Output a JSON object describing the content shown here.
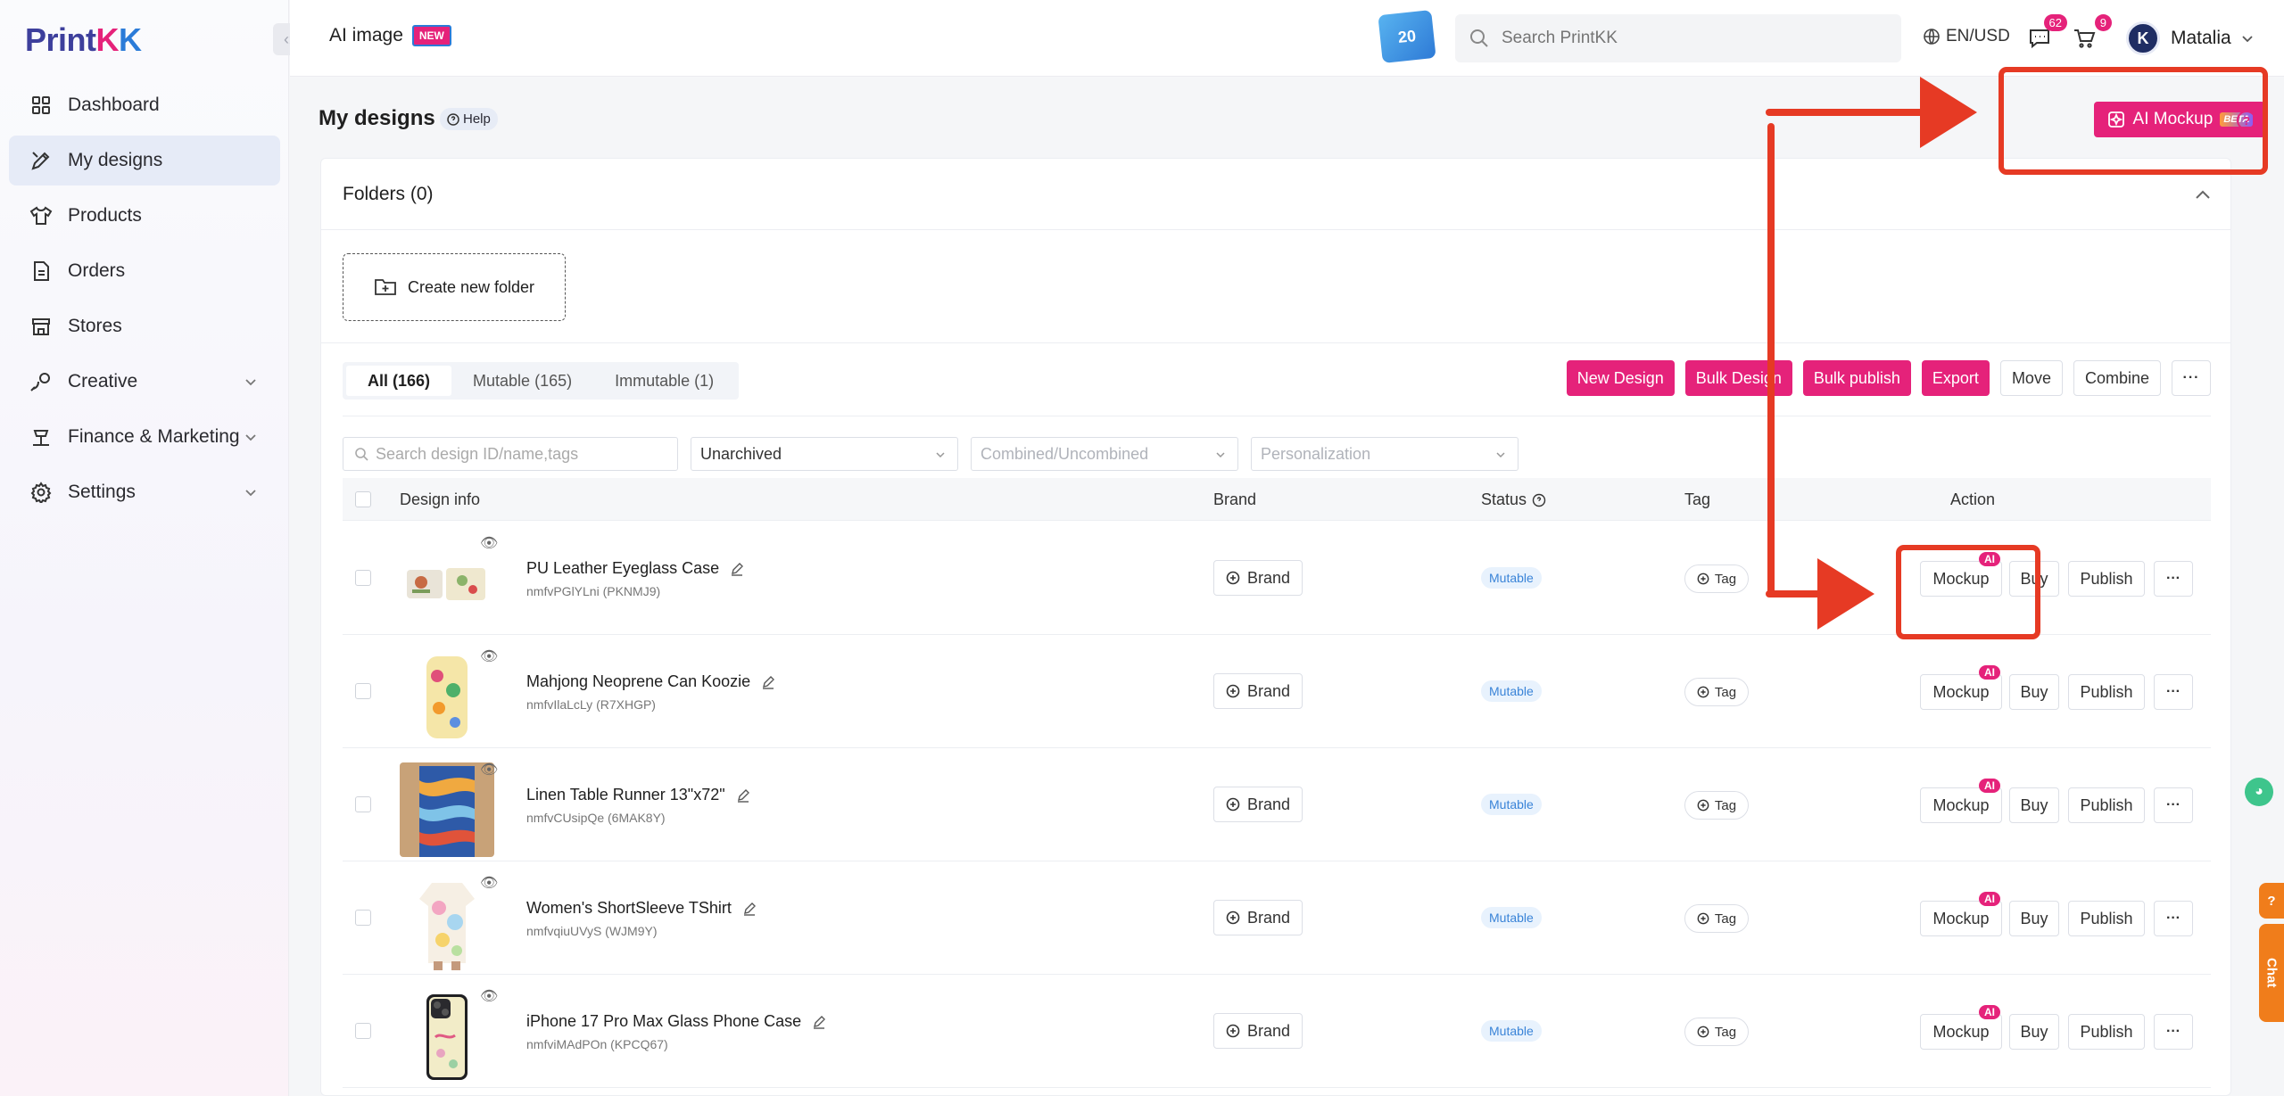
{
  "sidebar": {
    "logo": {
      "part1": "Print",
      "part2": "K",
      "part3": "K"
    },
    "items": [
      {
        "label": "Dashboard",
        "icon": "dashboard-icon"
      },
      {
        "label": "My designs",
        "icon": "designs-icon",
        "active": true
      },
      {
        "label": "Products",
        "icon": "shirt-icon"
      },
      {
        "label": "Orders",
        "icon": "document-icon"
      },
      {
        "label": "Stores",
        "icon": "store-icon"
      },
      {
        "label": "Creative",
        "icon": "creative-icon",
        "expandable": true
      },
      {
        "label": "Finance & Marketing",
        "icon": "finance-icon",
        "expandable": true
      },
      {
        "label": "Settings",
        "icon": "gear-icon",
        "expandable": true
      }
    ]
  },
  "header": {
    "ai_image": "AI image",
    "new_badge": "NEW",
    "promo": "20",
    "search_placeholder": "Search PrintKK",
    "lang": "EN/USD",
    "messages_count": "62",
    "cart_count": "9",
    "user_initial": "K",
    "user_name": "Matalia"
  },
  "main": {
    "title": "My designs",
    "help": "Help",
    "ai_mockup": "AI Mockup",
    "beta": "BETA",
    "folders_title": "Folders (0)",
    "create_folder": "Create new folder",
    "tabs": [
      "All (166)",
      "Mutable (165)",
      "Immutable (1)"
    ],
    "actions": {
      "new_design": "New Design",
      "bulk_design": "Bulk Design",
      "bulk_publish": "Bulk publish",
      "export": "Export",
      "move": "Move",
      "combine": "Combine"
    },
    "filters": {
      "search_placeholder": "Search design ID/name,tags",
      "archived": "Unarchived",
      "combined": "Combined/Uncombined",
      "personalization": "Personalization"
    },
    "columns": {
      "design_info": "Design info",
      "brand": "Brand",
      "status": "Status",
      "tag": "Tag",
      "action": "Action"
    },
    "row_labels": {
      "brand": "Brand",
      "tag": "Tag",
      "mockup": "Mockup",
      "ai": "AI",
      "buy": "Buy",
      "publish": "Publish"
    },
    "rows": [
      {
        "name": "PU Leather Eyeglass Case",
        "id": "nmfvPGlYLni (PKNMJ9)",
        "status": "Mutable"
      },
      {
        "name": "Mahjong Neoprene Can Koozie",
        "id": "nmfvIlaLcLy (R7XHGP)",
        "status": "Mutable"
      },
      {
        "name": "Linen Table Runner 13\"x72\"",
        "id": "nmfvCUsipQe (6MAK8Y)",
        "status": "Mutable"
      },
      {
        "name": "Women's ShortSleeve TShirt",
        "id": "nmfvqiuUVyS (WJM9Y)",
        "status": "Mutable"
      },
      {
        "name": "iPhone 17 Pro Max Glass Phone Case",
        "id": "nmfviMAdPOn (KPCQ67)",
        "status": "Mutable"
      }
    ]
  },
  "widgets": {
    "chat": "Chat"
  },
  "colors": {
    "accent": "#e5227a",
    "annotation": "#e63a24",
    "active_nav": "#e6ebf7"
  }
}
